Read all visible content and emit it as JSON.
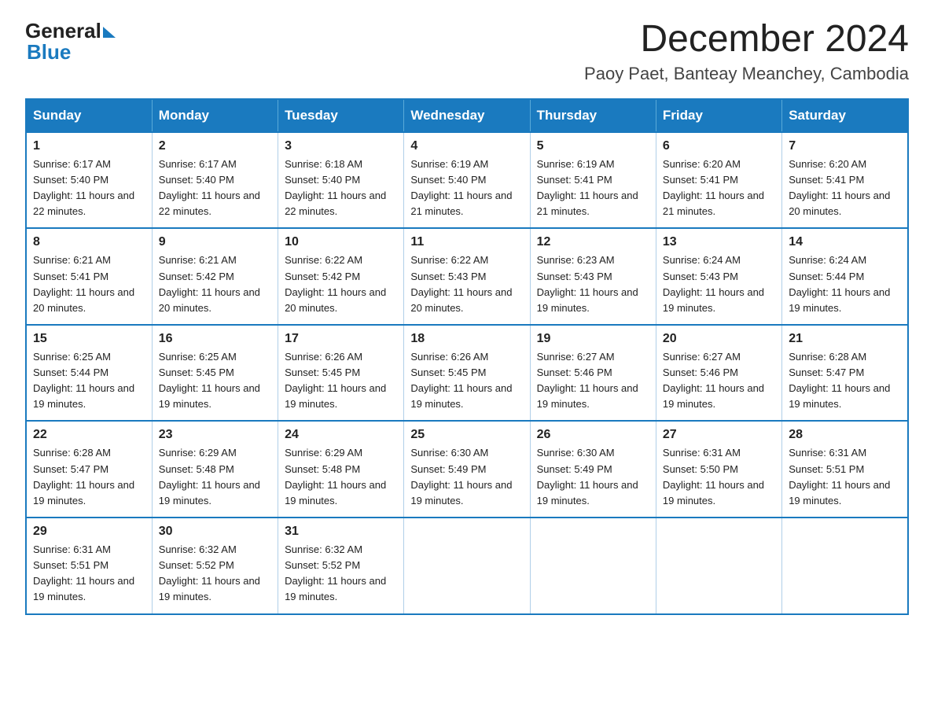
{
  "header": {
    "logo_top": "General",
    "logo_arrow": "",
    "logo_bottom": "Blue",
    "main_title": "December 2024",
    "subtitle": "Paoy Paet, Banteay Meanchey, Cambodia"
  },
  "calendar": {
    "days_of_week": [
      "Sunday",
      "Monday",
      "Tuesday",
      "Wednesday",
      "Thursday",
      "Friday",
      "Saturday"
    ],
    "weeks": [
      [
        {
          "day": "1",
          "sunrise": "Sunrise: 6:17 AM",
          "sunset": "Sunset: 5:40 PM",
          "daylight": "Daylight: 11 hours and 22 minutes."
        },
        {
          "day": "2",
          "sunrise": "Sunrise: 6:17 AM",
          "sunset": "Sunset: 5:40 PM",
          "daylight": "Daylight: 11 hours and 22 minutes."
        },
        {
          "day": "3",
          "sunrise": "Sunrise: 6:18 AM",
          "sunset": "Sunset: 5:40 PM",
          "daylight": "Daylight: 11 hours and 22 minutes."
        },
        {
          "day": "4",
          "sunrise": "Sunrise: 6:19 AM",
          "sunset": "Sunset: 5:40 PM",
          "daylight": "Daylight: 11 hours and 21 minutes."
        },
        {
          "day": "5",
          "sunrise": "Sunrise: 6:19 AM",
          "sunset": "Sunset: 5:41 PM",
          "daylight": "Daylight: 11 hours and 21 minutes."
        },
        {
          "day": "6",
          "sunrise": "Sunrise: 6:20 AM",
          "sunset": "Sunset: 5:41 PM",
          "daylight": "Daylight: 11 hours and 21 minutes."
        },
        {
          "day": "7",
          "sunrise": "Sunrise: 6:20 AM",
          "sunset": "Sunset: 5:41 PM",
          "daylight": "Daylight: 11 hours and 20 minutes."
        }
      ],
      [
        {
          "day": "8",
          "sunrise": "Sunrise: 6:21 AM",
          "sunset": "Sunset: 5:41 PM",
          "daylight": "Daylight: 11 hours and 20 minutes."
        },
        {
          "day": "9",
          "sunrise": "Sunrise: 6:21 AM",
          "sunset": "Sunset: 5:42 PM",
          "daylight": "Daylight: 11 hours and 20 minutes."
        },
        {
          "day": "10",
          "sunrise": "Sunrise: 6:22 AM",
          "sunset": "Sunset: 5:42 PM",
          "daylight": "Daylight: 11 hours and 20 minutes."
        },
        {
          "day": "11",
          "sunrise": "Sunrise: 6:22 AM",
          "sunset": "Sunset: 5:43 PM",
          "daylight": "Daylight: 11 hours and 20 minutes."
        },
        {
          "day": "12",
          "sunrise": "Sunrise: 6:23 AM",
          "sunset": "Sunset: 5:43 PM",
          "daylight": "Daylight: 11 hours and 19 minutes."
        },
        {
          "day": "13",
          "sunrise": "Sunrise: 6:24 AM",
          "sunset": "Sunset: 5:43 PM",
          "daylight": "Daylight: 11 hours and 19 minutes."
        },
        {
          "day": "14",
          "sunrise": "Sunrise: 6:24 AM",
          "sunset": "Sunset: 5:44 PM",
          "daylight": "Daylight: 11 hours and 19 minutes."
        }
      ],
      [
        {
          "day": "15",
          "sunrise": "Sunrise: 6:25 AM",
          "sunset": "Sunset: 5:44 PM",
          "daylight": "Daylight: 11 hours and 19 minutes."
        },
        {
          "day": "16",
          "sunrise": "Sunrise: 6:25 AM",
          "sunset": "Sunset: 5:45 PM",
          "daylight": "Daylight: 11 hours and 19 minutes."
        },
        {
          "day": "17",
          "sunrise": "Sunrise: 6:26 AM",
          "sunset": "Sunset: 5:45 PM",
          "daylight": "Daylight: 11 hours and 19 minutes."
        },
        {
          "day": "18",
          "sunrise": "Sunrise: 6:26 AM",
          "sunset": "Sunset: 5:45 PM",
          "daylight": "Daylight: 11 hours and 19 minutes."
        },
        {
          "day": "19",
          "sunrise": "Sunrise: 6:27 AM",
          "sunset": "Sunset: 5:46 PM",
          "daylight": "Daylight: 11 hours and 19 minutes."
        },
        {
          "day": "20",
          "sunrise": "Sunrise: 6:27 AM",
          "sunset": "Sunset: 5:46 PM",
          "daylight": "Daylight: 11 hours and 19 minutes."
        },
        {
          "day": "21",
          "sunrise": "Sunrise: 6:28 AM",
          "sunset": "Sunset: 5:47 PM",
          "daylight": "Daylight: 11 hours and 19 minutes."
        }
      ],
      [
        {
          "day": "22",
          "sunrise": "Sunrise: 6:28 AM",
          "sunset": "Sunset: 5:47 PM",
          "daylight": "Daylight: 11 hours and 19 minutes."
        },
        {
          "day": "23",
          "sunrise": "Sunrise: 6:29 AM",
          "sunset": "Sunset: 5:48 PM",
          "daylight": "Daylight: 11 hours and 19 minutes."
        },
        {
          "day": "24",
          "sunrise": "Sunrise: 6:29 AM",
          "sunset": "Sunset: 5:48 PM",
          "daylight": "Daylight: 11 hours and 19 minutes."
        },
        {
          "day": "25",
          "sunrise": "Sunrise: 6:30 AM",
          "sunset": "Sunset: 5:49 PM",
          "daylight": "Daylight: 11 hours and 19 minutes."
        },
        {
          "day": "26",
          "sunrise": "Sunrise: 6:30 AM",
          "sunset": "Sunset: 5:49 PM",
          "daylight": "Daylight: 11 hours and 19 minutes."
        },
        {
          "day": "27",
          "sunrise": "Sunrise: 6:31 AM",
          "sunset": "Sunset: 5:50 PM",
          "daylight": "Daylight: 11 hours and 19 minutes."
        },
        {
          "day": "28",
          "sunrise": "Sunrise: 6:31 AM",
          "sunset": "Sunset: 5:51 PM",
          "daylight": "Daylight: 11 hours and 19 minutes."
        }
      ],
      [
        {
          "day": "29",
          "sunrise": "Sunrise: 6:31 AM",
          "sunset": "Sunset: 5:51 PM",
          "daylight": "Daylight: 11 hours and 19 minutes."
        },
        {
          "day": "30",
          "sunrise": "Sunrise: 6:32 AM",
          "sunset": "Sunset: 5:52 PM",
          "daylight": "Daylight: 11 hours and 19 minutes."
        },
        {
          "day": "31",
          "sunrise": "Sunrise: 6:32 AM",
          "sunset": "Sunset: 5:52 PM",
          "daylight": "Daylight: 11 hours and 19 minutes."
        },
        null,
        null,
        null,
        null
      ]
    ]
  }
}
